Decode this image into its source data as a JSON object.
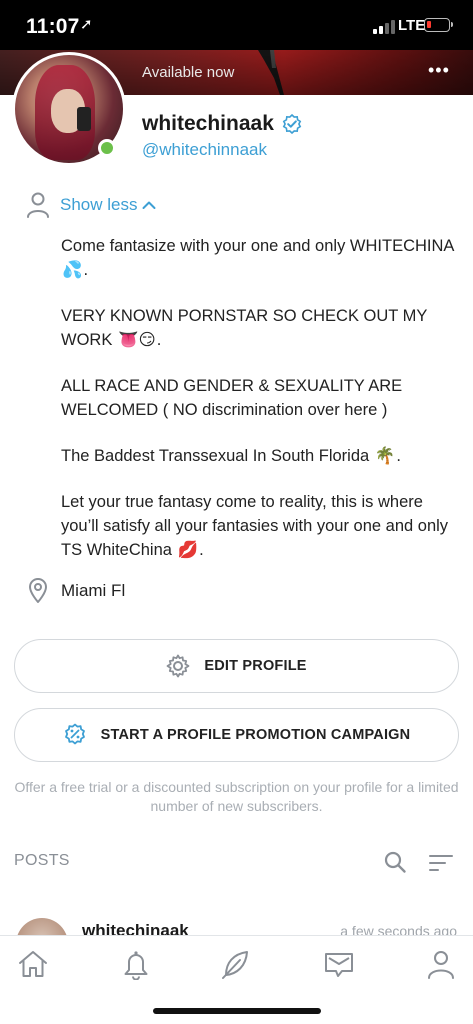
{
  "status_bar": {
    "time": "11:07",
    "network": "LTE"
  },
  "profile": {
    "availability": "Available now",
    "username": "whitechinaak",
    "handle": "@whitechinnaak",
    "show_less_label": "Show less",
    "bio": [
      {
        "text": "Come fantasize with your one and only WHITECHINA",
        "emoji": "💦",
        "suffix": "."
      },
      {
        "text": "VERY KNOWN PORNSTAR SO CHECK OUT MY WORK",
        "emoji": "👅😏",
        "suffix": "."
      },
      {
        "text": "ALL RACE AND GENDER & SEXUALITY ARE WELCOMED ( NO discrimination over here )",
        "emoji": "",
        "suffix": ""
      },
      {
        "text": "The Baddest Transsexual In South Florida",
        "emoji": "🌴",
        "suffix": "."
      },
      {
        "text": "Let your true fantasy come to reality, this is where you’ll satisfy all your fantasies with your one and only TS WhiteChina",
        "emoji": "💋",
        "suffix": "."
      }
    ],
    "location": "Miami Fl"
  },
  "actions": {
    "edit_profile": "EDIT PROFILE",
    "promotion": "START A PROFILE PROMOTION CAMPAIGN",
    "promotion_note": "Offer a free trial or a discounted subscription on your profile for a limited number of new subscribers."
  },
  "posts": {
    "header": "POSTS",
    "items": [
      {
        "author": "whitechinaak",
        "time": "a few seconds ago"
      }
    ]
  },
  "colors": {
    "accent": "#3d9fd4",
    "online": "#6cc04a",
    "muted_text": "#a9aeb4",
    "icon_gray": "#8a8f96"
  },
  "tab_bar": {
    "items": [
      "home-icon",
      "bell-icon",
      "feather-icon",
      "messages-icon",
      "profile-icon"
    ]
  }
}
